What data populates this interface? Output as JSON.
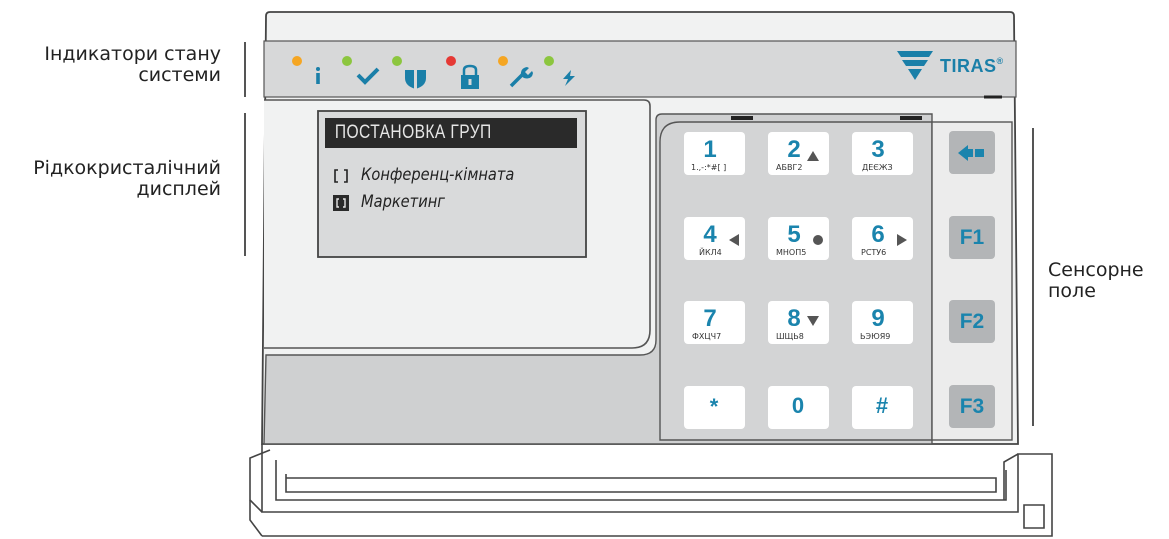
{
  "labels": {
    "indicators_line1": "Індикатори стану",
    "indicators_line2": "системи",
    "display_line1": "Рідкокристалічний",
    "display_line2": "дисплей",
    "touch_line1": "Сенсорне",
    "touch_line2": "поле"
  },
  "brand": {
    "name": "TIRAS",
    "mark": "®",
    "color": "#1a7fa8"
  },
  "indicators": [
    {
      "name": "info",
      "led_color": "#f5a623",
      "icon": "info-icon"
    },
    {
      "name": "check",
      "led_color": "#8cc63f",
      "icon": "check-icon"
    },
    {
      "name": "shield",
      "led_color": "#8cc63f",
      "icon": "shield-icon"
    },
    {
      "name": "lock",
      "led_color": "#e53935",
      "icon": "lock-icon"
    },
    {
      "name": "wrench",
      "led_color": "#f5a623",
      "icon": "wrench-icon"
    },
    {
      "name": "power",
      "led_color": "#8cc63f",
      "icon": "lightning-icon"
    }
  ],
  "lcd": {
    "title": "ПОСТАНОВКА ГРУП",
    "rows": [
      {
        "text": "Конференц-кімната",
        "selected": false
      },
      {
        "text": "Маркетинг",
        "selected": true
      }
    ]
  },
  "keypad": [
    {
      "key": "1",
      "sub": "1.,-:*#[ ]",
      "arrow": ""
    },
    {
      "key": "2",
      "sub": "АБВГ2",
      "arrow": "up"
    },
    {
      "key": "3",
      "sub": "ДЕЄЖЗ",
      "arrow": ""
    },
    {
      "key": "4",
      "sub": "ЙКЛ4",
      "arrow": "left"
    },
    {
      "key": "5",
      "sub": "МНОП5",
      "arrow": "dot"
    },
    {
      "key": "6",
      "sub": "РСТУ6",
      "arrow": "right"
    },
    {
      "key": "7",
      "sub": "ФХЦЧ7",
      "arrow": ""
    },
    {
      "key": "8",
      "sub": "ШЩЬ8",
      "arrow": "down"
    },
    {
      "key": "9",
      "sub": "ЬЭЮЯ9",
      "arrow": ""
    },
    {
      "key": "*",
      "sub": "",
      "arrow": ""
    },
    {
      "key": "0",
      "sub": "",
      "arrow": ""
    },
    {
      "key": "#",
      "sub": "",
      "arrow": ""
    }
  ],
  "function_keys": [
    {
      "label": "",
      "icon": "backspace-icon"
    },
    {
      "label": "F1"
    },
    {
      "label": "F2"
    },
    {
      "label": "F3"
    }
  ],
  "colors": {
    "accent": "#1a84ad",
    "panel": "#d7d8d9",
    "lcd_screen": "#d9dadb",
    "lcd_title_bg": "#2a2a2a"
  }
}
